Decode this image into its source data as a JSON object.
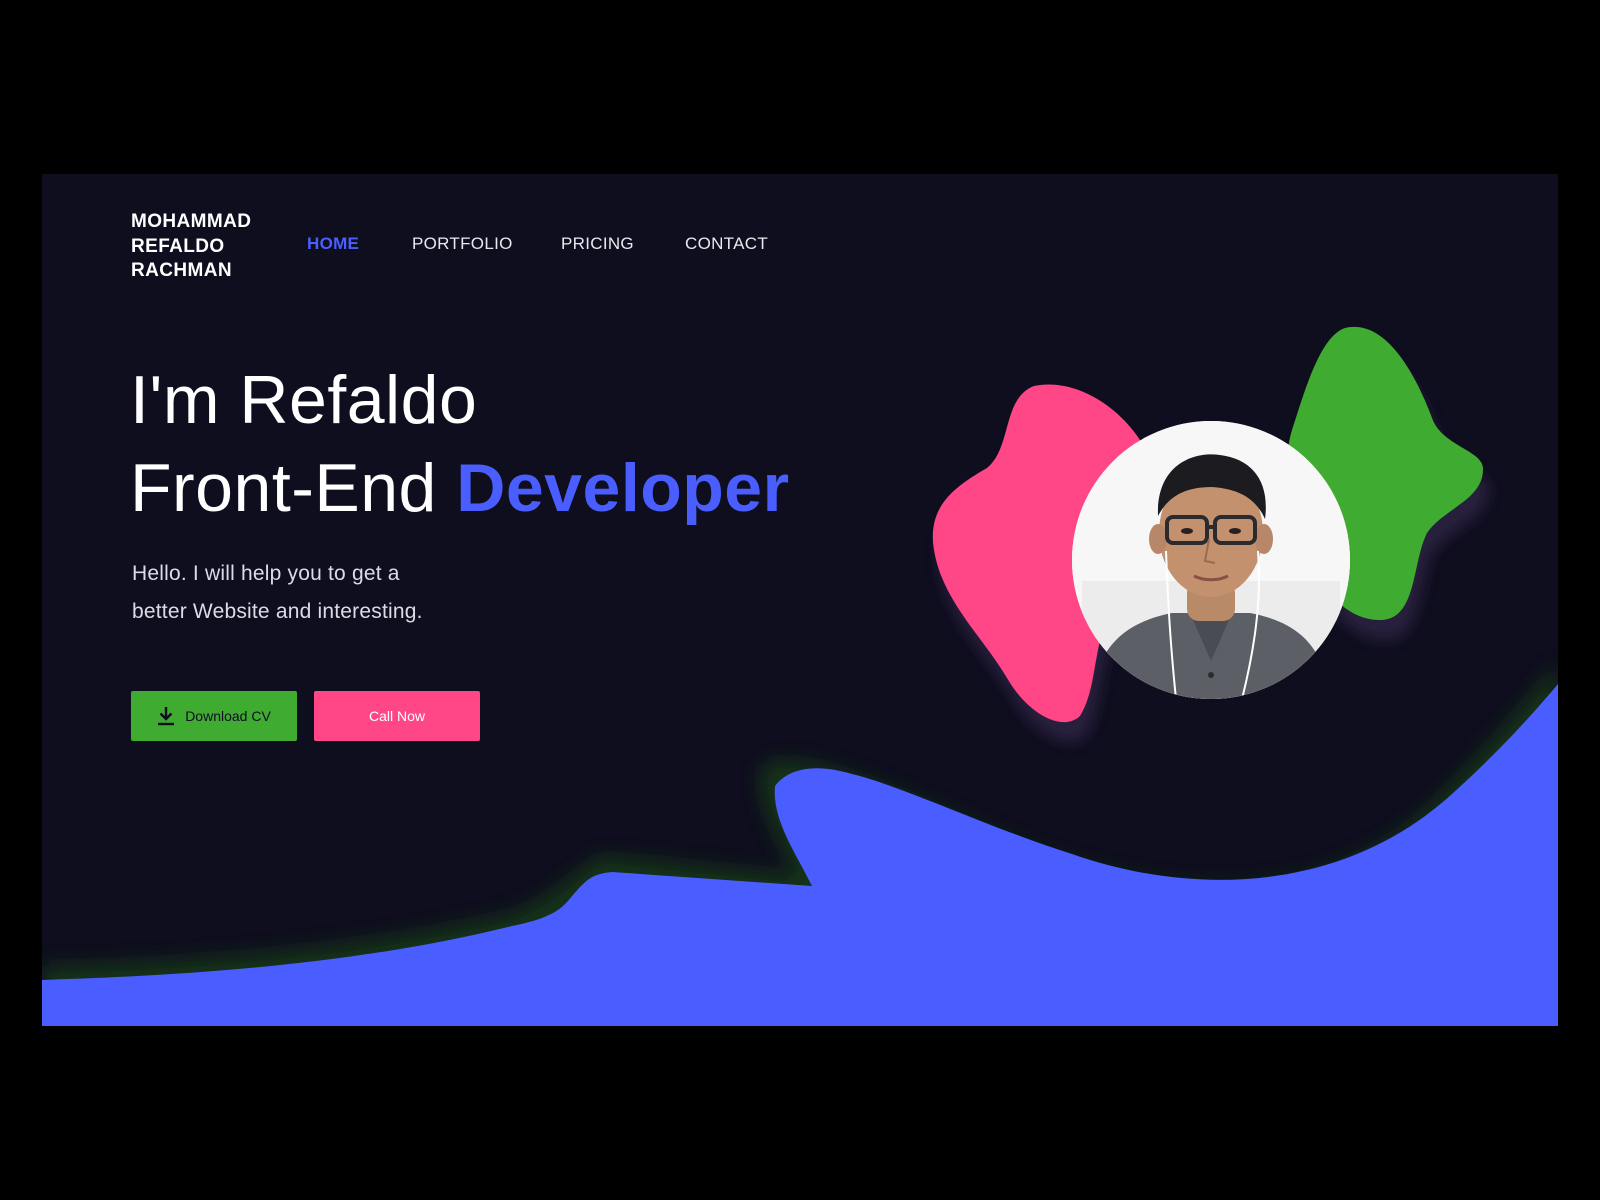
{
  "brand": {
    "name_lines": [
      "MOHAMMAD",
      "REFALDO",
      "RACHMAN"
    ]
  },
  "nav": {
    "items": [
      {
        "label": "HOME",
        "active": true
      },
      {
        "label": "PORTFOLIO",
        "active": false
      },
      {
        "label": "PRICING",
        "active": false
      },
      {
        "label": "CONTACT",
        "active": false
      }
    ]
  },
  "hero": {
    "line1": "I'm Refaldo",
    "line2_plain": "Front-End ",
    "line2_highlight": "Developer",
    "subtext": "Hello. I will help you to get a better Website and interesting.",
    "download_button": {
      "label": "Download CV",
      "icon": "download-icon"
    },
    "call_button": {
      "label": "Call Now"
    }
  },
  "colors": {
    "background": "#0f0e1f",
    "accent_blue": "#4a5eff",
    "green": "#40ab31",
    "pink": "#ff4787",
    "text": "#ffffff"
  }
}
